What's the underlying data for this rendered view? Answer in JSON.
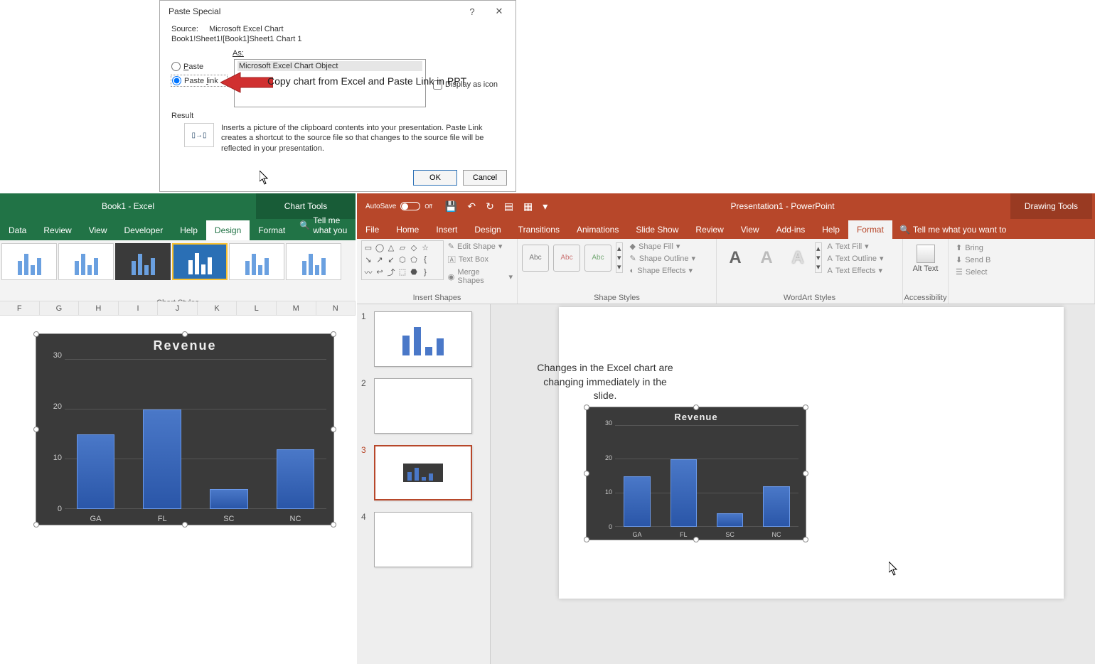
{
  "dialog": {
    "title": "Paste Special",
    "help": "?",
    "close": "✕",
    "source_lbl": "Source:",
    "source_val": "Microsoft Excel Chart",
    "source_path": "Book1!Sheet1![Book1]Sheet1 Chart 1",
    "as_lbl": "As:",
    "paste_lbl": "Paste",
    "pastelink_lbl": "Paste link",
    "list_item": "Microsoft Excel Chart Object",
    "display_icon": "Display as icon",
    "result_lbl": "Result",
    "result_txt": "Inserts a picture of the clipboard contents into your presentation. Paste Link creates a shortcut to the source file so that changes to the source file will be reflected in your presentation.",
    "ok": "OK",
    "cancel": "Cancel"
  },
  "annotation": {
    "arrow_text": "Copy chart from Excel and Paste Link in PPT",
    "slide_text": "Changes in the Excel chart are changing immediately in the slide."
  },
  "excel": {
    "title": "Book1  -  Excel",
    "chart_tools": "Chart Tools",
    "tabs": [
      "Data",
      "Review",
      "View",
      "Developer",
      "Help",
      "Design",
      "Format"
    ],
    "tmw": "Tell me what you",
    "styles_lbl": "Chart Styles",
    "cols": [
      "F",
      "G",
      "H",
      "I",
      "J",
      "K",
      "L",
      "M",
      "N"
    ]
  },
  "ppt": {
    "autosave": "AutoSave",
    "off": "Off",
    "title": "Presentation1  -  PowerPoint",
    "drawing_tools": "Drawing Tools",
    "tabs": [
      "File",
      "Home",
      "Insert",
      "Design",
      "Transitions",
      "Animations",
      "Slide Show",
      "Review",
      "View",
      "Add-ins",
      "Help",
      "Format"
    ],
    "tmw": "Tell me what you want to",
    "groups": {
      "insert_shapes": "Insert Shapes",
      "shape_styles": "Shape Styles",
      "wordart_styles": "WordArt Styles",
      "accessibility": "Accessibility"
    },
    "menus": {
      "edit_shape": "Edit Shape",
      "text_box": "Text Box",
      "merge_shapes": "Merge Shapes",
      "shape_fill": "Shape Fill",
      "shape_outline": "Shape Outline",
      "shape_effects": "Shape Effects",
      "text_fill": "Text Fill",
      "text_outline": "Text Outline",
      "text_effects": "Text Effects",
      "alt_text": "Alt Text",
      "bring": "Bring",
      "send": "Send B",
      "select": "Select"
    },
    "abc": "Abc",
    "wart": "A",
    "slides": [
      "1",
      "2",
      "3",
      "4"
    ]
  },
  "chart_data": {
    "type": "bar",
    "title": "Revenue",
    "categories": [
      "GA",
      "FL",
      "SC",
      "NC"
    ],
    "values": [
      15,
      20,
      4,
      12
    ],
    "ylabel": "",
    "xlabel": "",
    "ylim": [
      0,
      30
    ],
    "yticks": [
      0,
      10,
      20,
      30
    ]
  }
}
